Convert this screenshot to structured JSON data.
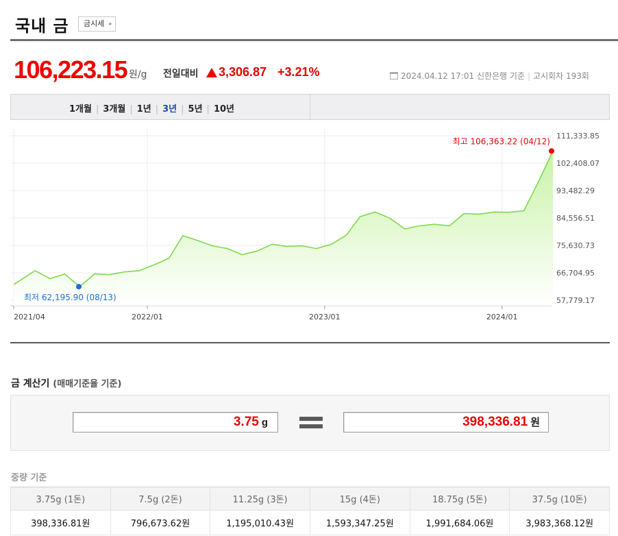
{
  "header": {
    "title": "국내 금",
    "sise_button": "금시세",
    "sise_arrow": "▸"
  },
  "price": {
    "value": "106,223.15",
    "unit": "원/g",
    "compare_label": "전일대비",
    "change_amount": "3,306.87",
    "change_rate": "+3.21%",
    "up_color": "#ee0000"
  },
  "meta": {
    "datetime": "2024.04.12 17:01",
    "bank": "신한은행 기준",
    "notice": "고시회차 193회"
  },
  "period_tabs": [
    {
      "label": "1개월",
      "active": false
    },
    {
      "label": "3개월",
      "active": false
    },
    {
      "label": "1년",
      "active": false
    },
    {
      "label": "3년",
      "active": true
    },
    {
      "label": "5년",
      "active": false
    },
    {
      "label": "10년",
      "active": false
    }
  ],
  "chart_data": {
    "type": "area",
    "x_tick_labels": [
      "2021/04",
      "2022/01",
      "2023/01",
      "2024/01"
    ],
    "x_ticks": [
      "2021-04",
      "2022-01",
      "2023-01",
      "2024-01"
    ],
    "x_range": [
      "2021-04",
      "2024-04"
    ],
    "y_tick_labels": [
      "111,333.85",
      "102,408.07",
      "93,482.29",
      "84,556.51",
      "75,630.73",
      "66,704.95",
      "57,779.17"
    ],
    "y_ticks": [
      111333.85,
      102408.07,
      93482.29,
      84556.51,
      75630.73,
      66704.95,
      57779.17
    ],
    "ylim": [
      57779.17,
      111333.85
    ],
    "grid": true,
    "line_color": "#7fd84a",
    "fill_top_color": "#c9f3a8",
    "series": [
      {
        "values": [
          [
            "2021-04",
            62900
          ],
          [
            "2021-05",
            67400
          ],
          [
            "2021-06",
            64800
          ],
          [
            "2021-07",
            66300
          ],
          [
            "2021-08",
            62200
          ],
          [
            "2021-09",
            66400
          ],
          [
            "2021-10",
            66100
          ],
          [
            "2021-11",
            67000
          ],
          [
            "2021-12",
            67400
          ],
          [
            "2022-01",
            69300
          ],
          [
            "2022-02",
            71500
          ],
          [
            "2022-03",
            78800
          ],
          [
            "2022-04",
            77200
          ],
          [
            "2022-05",
            75500
          ],
          [
            "2022-06",
            74600
          ],
          [
            "2022-07",
            72600
          ],
          [
            "2022-08",
            73800
          ],
          [
            "2022-09",
            76000
          ],
          [
            "2022-10",
            75300
          ],
          [
            "2022-11",
            75500
          ],
          [
            "2022-12",
            74600
          ],
          [
            "2023-01",
            76000
          ],
          [
            "2023-02",
            79000
          ],
          [
            "2023-03",
            85000
          ],
          [
            "2023-04",
            86500
          ],
          [
            "2023-05",
            84500
          ],
          [
            "2023-06",
            81000
          ],
          [
            "2023-07",
            82000
          ],
          [
            "2023-08",
            82500
          ],
          [
            "2023-09",
            82000
          ],
          [
            "2023-10",
            86000
          ],
          [
            "2023-11",
            85800
          ],
          [
            "2023-12",
            86500
          ],
          [
            "2024-01",
            86400
          ],
          [
            "2024-02",
            86900
          ],
          [
            "2024-03",
            96000
          ],
          [
            "2024-04",
            106363.22
          ]
        ]
      }
    ],
    "annotations": {
      "max": {
        "label": "최고 106,363.22 (04/12)",
        "value": 106363.22,
        "date": "2024-04-12",
        "color": "#ee0000"
      },
      "min": {
        "label": "최저 62,195.90 (08/13)",
        "value": 62195.9,
        "date": "2021-08-13",
        "color": "#1a6fd4"
      }
    }
  },
  "calculator": {
    "title": "금 계산기",
    "subtitle": "(매매기준율 기준)",
    "input_value": "3.75",
    "input_unit": "g",
    "output_value": "398,336.81",
    "output_unit": "원"
  },
  "weight_table": {
    "title": "중량 기준",
    "headers": [
      "3.75g (1돈)",
      "7.5g (2돈)",
      "11.25g (3돈)",
      "15g (4돈)",
      "18.75g (5돈)",
      "37.5g (10돈)"
    ],
    "values": [
      "398,336.81원",
      "796,673.62원",
      "1,195,010.43원",
      "1,593,347.25원",
      "1,991,684.06원",
      "3,983,368.12원"
    ]
  }
}
